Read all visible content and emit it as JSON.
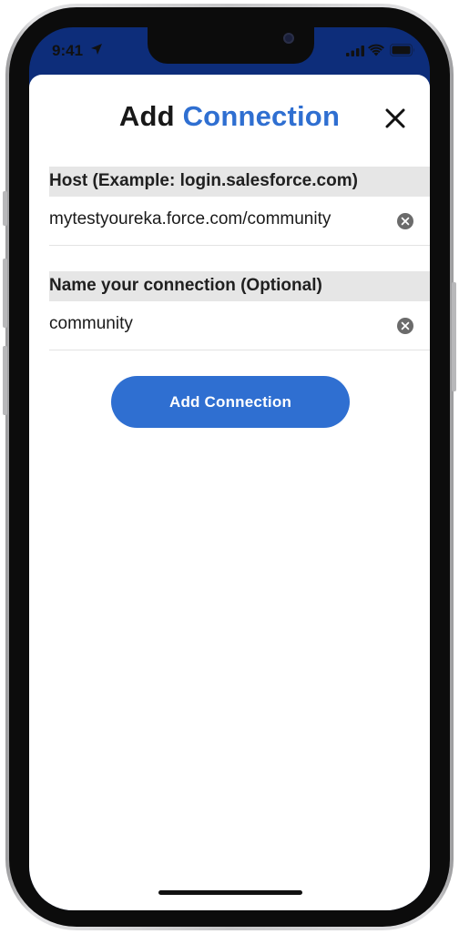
{
  "status_bar": {
    "time": "9:41",
    "icons": [
      "location-icon",
      "cellular-signal-icon",
      "wifi-icon",
      "battery-icon"
    ]
  },
  "header": {
    "title_part1": "Add",
    "title_part2": "Connection",
    "close_icon": "close-icon"
  },
  "host_section": {
    "label": "Host (Example: login.salesforce.com)",
    "value": "mytestyoureka.force.com/community",
    "clear_icon": "clear-icon"
  },
  "name_section": {
    "label": "Name your connection (Optional)",
    "value": "community",
    "clear_icon": "clear-icon"
  },
  "actions": {
    "add_connection_label": "Add Connection"
  },
  "colors": {
    "accent": "#2f6fd1",
    "status_bar_bg": "#0d2d7a",
    "section_header_bg": "#e6e6e6"
  }
}
